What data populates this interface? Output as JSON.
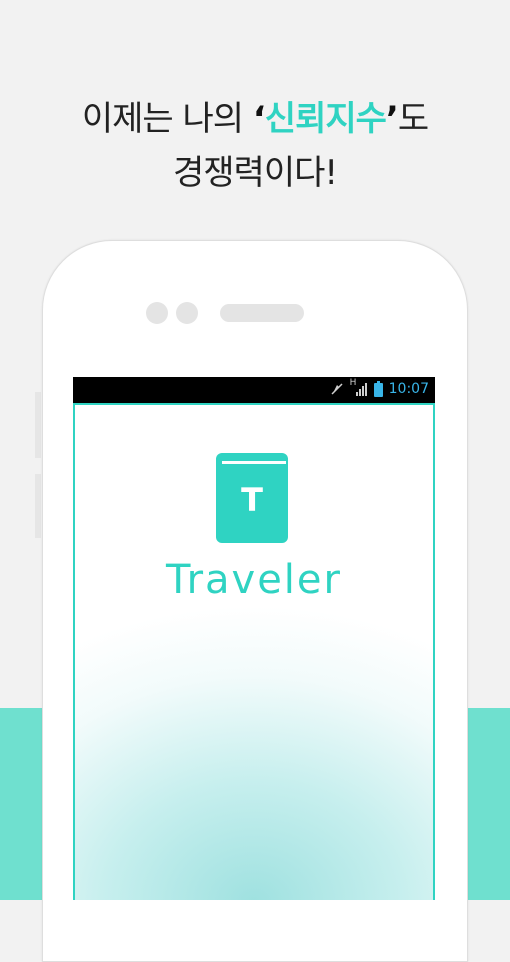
{
  "headline": {
    "line1_prefix": "이제는 나의 ",
    "open_quote": "‘",
    "highlight": "신뢰지수",
    "close_quote": "’",
    "line1_suffix": "도",
    "line2": "경쟁력이다!"
  },
  "status_bar": {
    "time": "10:07",
    "network_label": "H",
    "icons": [
      "mute-icon",
      "signal-icon",
      "battery-icon"
    ]
  },
  "app": {
    "name": "Traveler",
    "logo_letter": "T"
  },
  "colors": {
    "accent": "#2fd3c2",
    "band": "#6fe0cf",
    "background": "#f2f2f2",
    "status_text": "#39b5e8"
  }
}
